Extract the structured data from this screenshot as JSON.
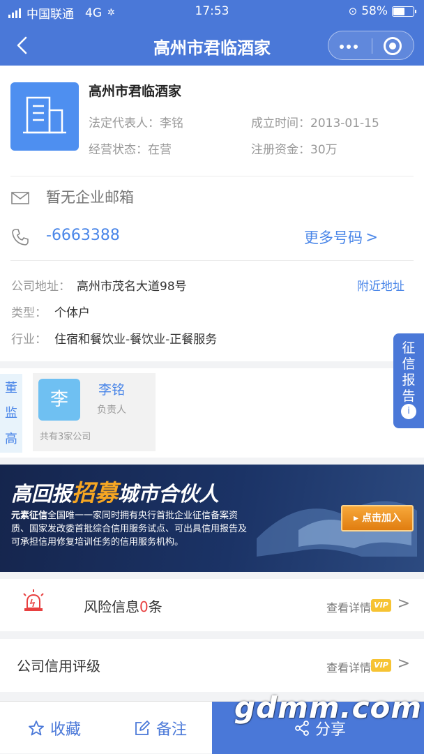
{
  "status_bar": {
    "carrier": "中国联通",
    "network": "4G",
    "time": "17:53",
    "battery": "58%"
  },
  "nav": {
    "title": "高州市君临酒家"
  },
  "company": {
    "name": "高州市君临酒家",
    "legal_rep_label": "法定代表人：",
    "legal_rep": "李铭",
    "founded_label": "成立时间：",
    "founded": "2013-01-15",
    "status_label": "经营状态：",
    "status": "在营",
    "capital_label": "注册资金：",
    "capital": "30万"
  },
  "contact": {
    "email": "暂无企业邮箱",
    "phone": "-6663388",
    "more_numbers": "更多号码",
    "more_arrow": ">"
  },
  "info": {
    "address_label": "公司地址：",
    "address": "高州市茂名大道98号",
    "nearby": "附近地址",
    "type_label": "类型：",
    "type": "个体户",
    "industry_label": "行业：",
    "industry": "住宿和餐饮业-餐饮业-正餐服务"
  },
  "credit_tab": {
    "label": "征信报告",
    "icon": "i"
  },
  "people": {
    "tabs": [
      "董",
      "监",
      "高"
    ],
    "avatar_char": "李",
    "name": "李铭",
    "role": "负责人",
    "companies": "共有3家公司"
  },
  "banner": {
    "title_pre": "高回报",
    "title_hl": "招募",
    "title_post": "城市合伙人",
    "brand": "元素征信",
    "desc": "全国唯一一家同时拥有央行首批企业征信备案资质、国家发改委首批综合信用服务试点、可出具信用报告及可承担信用修复培训任务的信用服务机构。",
    "cta": "▸ 点击加入"
  },
  "risk": {
    "label": "风险信息",
    "count": "0",
    "unit": "条",
    "detail": "查看详情",
    "vip": "VIP"
  },
  "rating": {
    "label": "公司信用评级",
    "detail": "查看详情",
    "vip": "VIP"
  },
  "bottom": {
    "favorite": "收藏",
    "note": "备注",
    "share": "分享"
  },
  "chevron": ">",
  "watermark": "gdmm.com",
  "colors": {
    "primary": "#4a78d8",
    "link": "#4a86e8",
    "risk": "#e84040",
    "vip": "#f6c333"
  }
}
